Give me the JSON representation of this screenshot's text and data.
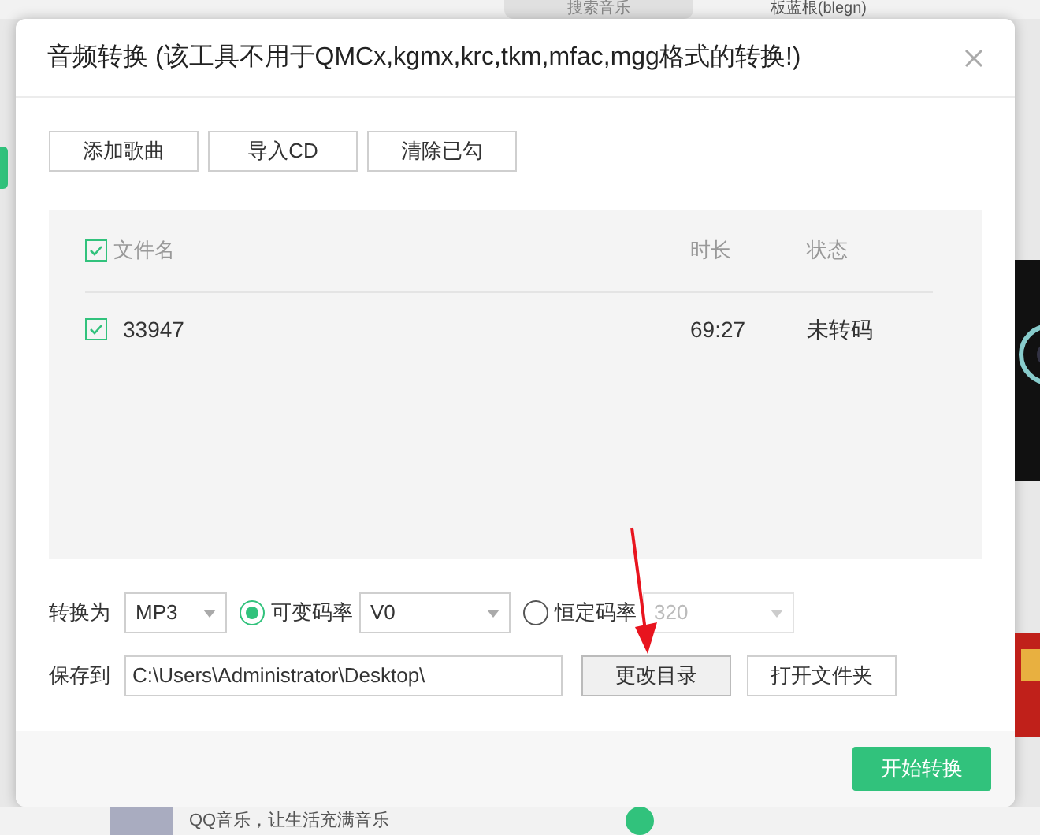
{
  "app": {
    "search_placeholder": "搜索音乐",
    "user_name": "板蓝根(blegn)",
    "now_playing": "QQ音乐，让生活充满音乐"
  },
  "dialog": {
    "title": "音频转换 (该工具不用于QMCx,kgmx,krc,tkm,mfac,mgg格式的转换!)",
    "toolbar": [
      "添加歌曲",
      "导入CD",
      "清除已勾"
    ],
    "table": {
      "select_all_checked": true,
      "columns": [
        "文件名",
        "时长",
        "状态"
      ],
      "rows": [
        {
          "checked": true,
          "cells": [
            "33947",
            "69:27",
            "未转码"
          ]
        }
      ]
    },
    "convert": {
      "label": "转换为",
      "format": "MP3",
      "options": [
        {
          "label": "可变码率",
          "selected": true,
          "value": "V0"
        },
        {
          "label": "恒定码率",
          "selected": false,
          "value": "320"
        }
      ]
    },
    "save": {
      "label": "保存到",
      "path": "C:\\Users\\Administrator\\Desktop\\",
      "buttons": [
        {
          "label": "更改目录",
          "highlighted": true
        },
        {
          "label": "打开文件夹",
          "highlighted": false
        }
      ]
    },
    "start_button": "开始转换"
  }
}
